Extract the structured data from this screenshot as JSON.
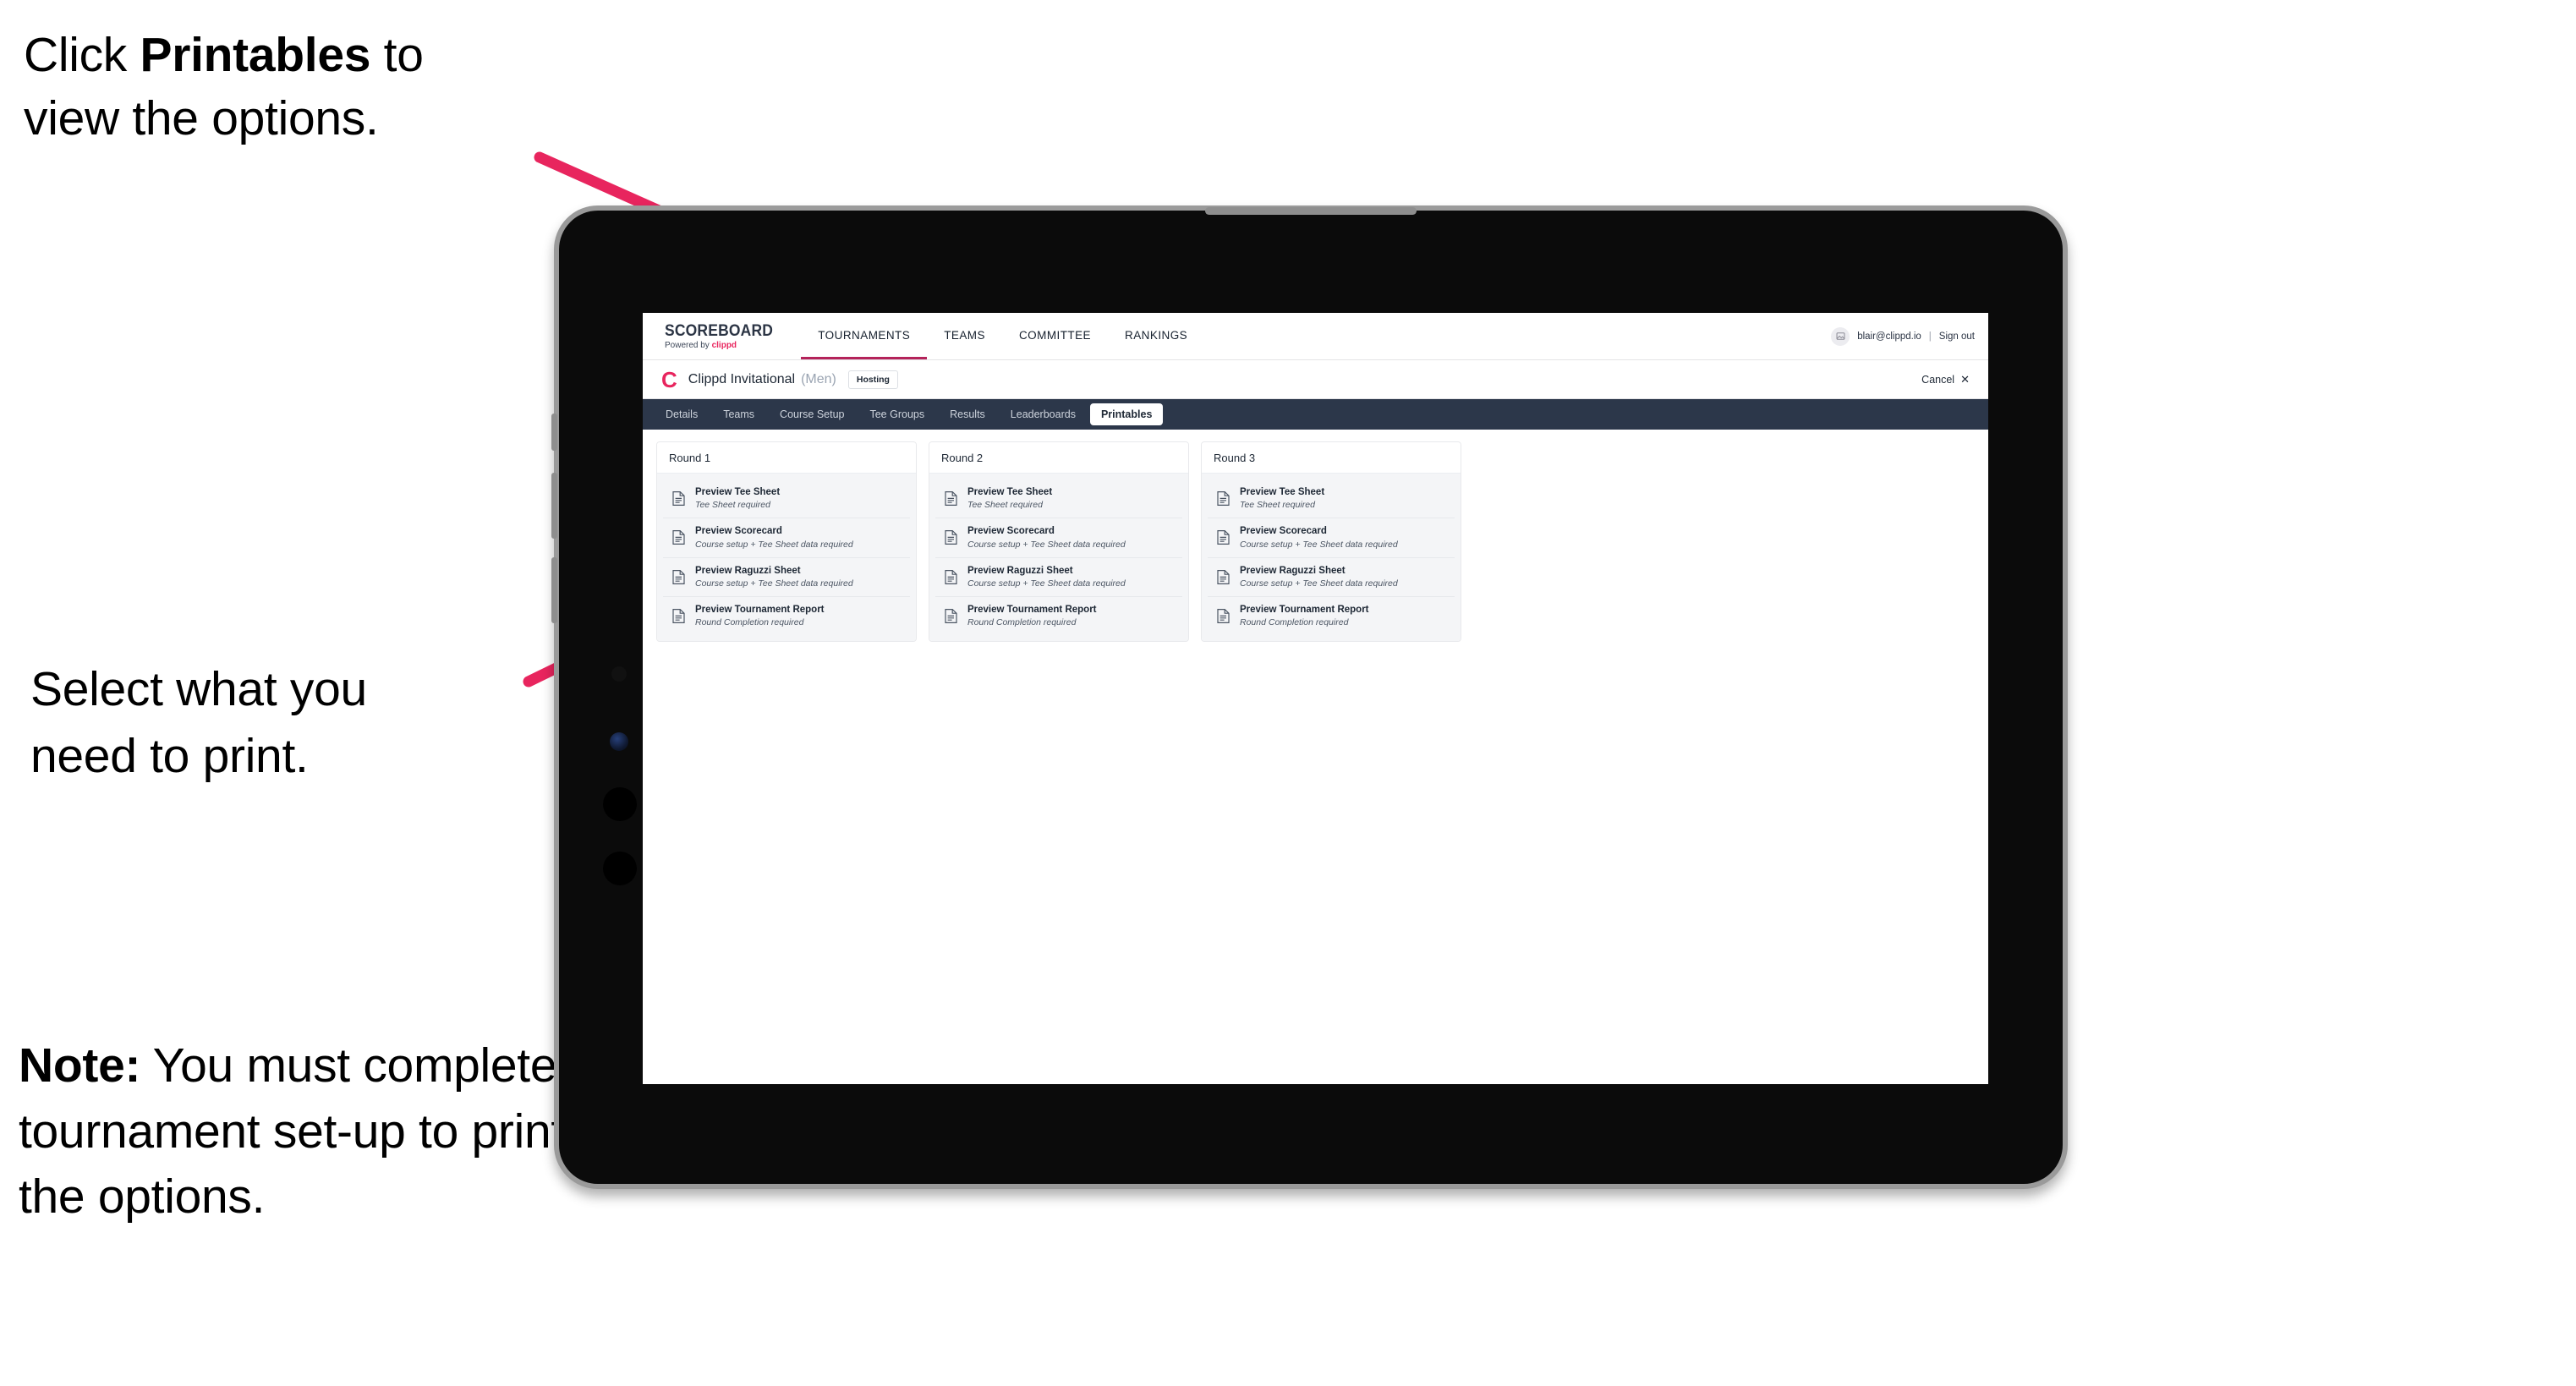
{
  "annotations": [
    {
      "id": "annot-1",
      "pre": "Click ",
      "bold": "Printables",
      "post": " to view the options."
    },
    {
      "id": "annot-2",
      "pre": "",
      "bold": "",
      "post": "Select what you need to print."
    },
    {
      "id": "annot-3",
      "pre": "",
      "bold": "Note:",
      "post": " You must complete the tournament set-up to print all the options."
    }
  ],
  "annot_1_pre": "Click ",
  "annot_1_bold": "Printables",
  "annot_1_post": " to",
  "annot_1_line2": "view the options.",
  "annot_2_line1": "Select what you",
  "annot_2_line2": " need to print.",
  "annot_3_bold": "Note:",
  "annot_3_rest": " You must complete the tournament set-up to print all the options.",
  "app": {
    "brand": {
      "title": "SCOREBOARD",
      "sub_prefix": "Powered by ",
      "sub_brand": "clippd"
    },
    "top_nav": [
      {
        "label": "TOURNAMENTS",
        "active": true
      },
      {
        "label": "TEAMS",
        "active": false
      },
      {
        "label": "COMMITTEE",
        "active": false
      },
      {
        "label": "RANKINGS",
        "active": false
      }
    ],
    "account": {
      "avatar_icon": "user-avatar-icon",
      "email": "blair@clippd.io",
      "separator": "|",
      "sign_out": "Sign out"
    },
    "tournament_bar": {
      "logo_letter": "C",
      "name": "Clippd Invitational",
      "gender": "(Men)",
      "status_badge": "Hosting",
      "cancel_label": "Cancel",
      "cancel_icon": "close-x-icon"
    },
    "sub_nav": [
      {
        "label": "Details",
        "active": false
      },
      {
        "label": "Teams",
        "active": false
      },
      {
        "label": "Course Setup",
        "active": false
      },
      {
        "label": "Tee Groups",
        "active": false
      },
      {
        "label": "Results",
        "active": false
      },
      {
        "label": "Leaderboards",
        "active": false
      },
      {
        "label": "Printables",
        "active": true
      }
    ],
    "rounds": [
      {
        "title": "Round 1",
        "items": [
          {
            "title": "Preview Tee Sheet",
            "sub": "Tee Sheet required",
            "icon": "document-icon"
          },
          {
            "title": "Preview Scorecard",
            "sub": "Course setup + Tee Sheet data required",
            "icon": "document-icon"
          },
          {
            "title": "Preview Raguzzi Sheet",
            "sub": "Course setup + Tee Sheet data required",
            "icon": "document-icon"
          },
          {
            "title": "Preview Tournament Report",
            "sub": "Round Completion required",
            "icon": "document-icon"
          }
        ]
      },
      {
        "title": "Round 2",
        "items": [
          {
            "title": "Preview Tee Sheet",
            "sub": "Tee Sheet required",
            "icon": "document-icon"
          },
          {
            "title": "Preview Scorecard",
            "sub": "Course setup + Tee Sheet data required",
            "icon": "document-icon"
          },
          {
            "title": "Preview Raguzzi Sheet",
            "sub": "Course setup + Tee Sheet data required",
            "icon": "document-icon"
          },
          {
            "title": "Preview Tournament Report",
            "sub": "Round Completion required",
            "icon": "document-icon"
          }
        ]
      },
      {
        "title": "Round 3",
        "items": [
          {
            "title": "Preview Tee Sheet",
            "sub": "Tee Sheet required",
            "icon": "document-icon"
          },
          {
            "title": "Preview Scorecard",
            "sub": "Course setup + Tee Sheet data required",
            "icon": "document-icon"
          },
          {
            "title": "Preview Raguzzi Sheet",
            "sub": "Course setup + Tee Sheet data required",
            "icon": "document-icon"
          },
          {
            "title": "Preview Tournament Report",
            "sub": "Round Completion required",
            "icon": "document-icon"
          }
        ]
      }
    ]
  },
  "colors": {
    "accent_pink": "#e8255e",
    "arrow_pink": "#e8255e",
    "subnav_dark": "#2c374a",
    "card_grey": "#f4f5f7",
    "device_black": "#0b0b0b",
    "device_bezel": "#9a9a9a"
  }
}
